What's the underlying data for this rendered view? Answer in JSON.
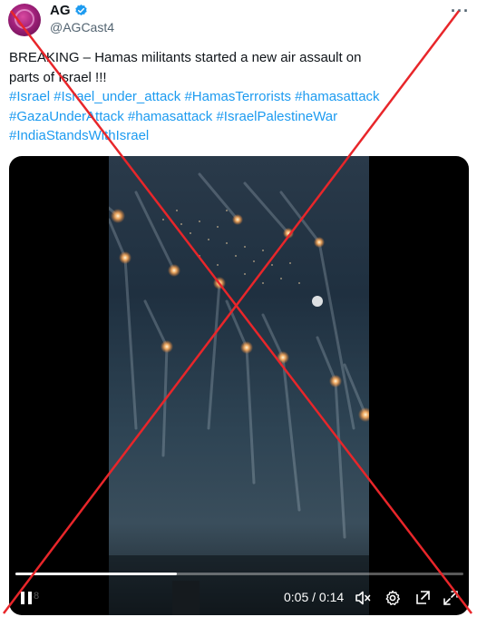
{
  "author": {
    "display_name": "AG",
    "handle": "@AGCast4",
    "verified": true,
    "verified_color": "#1d9bf0"
  },
  "menu": {
    "icon": "more-horizontal-icon",
    "glyph": "···"
  },
  "post": {
    "text_line1": "BREAKING – Hamas militants started a new air assault on",
    "text_line2": "parts of Israel !!!",
    "hashtags": [
      "#Israel",
      "#Israel_under_attack",
      "#HamasTerrorists",
      "#hamasattack",
      "#GazaUnderAttack",
      "#hamasattack",
      "#IsraelPalestineWar",
      "#IndiaStandsWithIsrael"
    ]
  },
  "video": {
    "time_display": "0:05 / 0:14",
    "progress_fraction": 0.36,
    "watermark": "8",
    "controls": [
      "pause-icon",
      "mute-icon",
      "settings-icon",
      "pop-out-icon",
      "fullscreen-icon"
    ]
  },
  "overlay": {
    "cross_color": "#e8262a"
  },
  "colors": {
    "link": "#1d9bf0",
    "text": "#0f1419",
    "muted": "#536471"
  }
}
